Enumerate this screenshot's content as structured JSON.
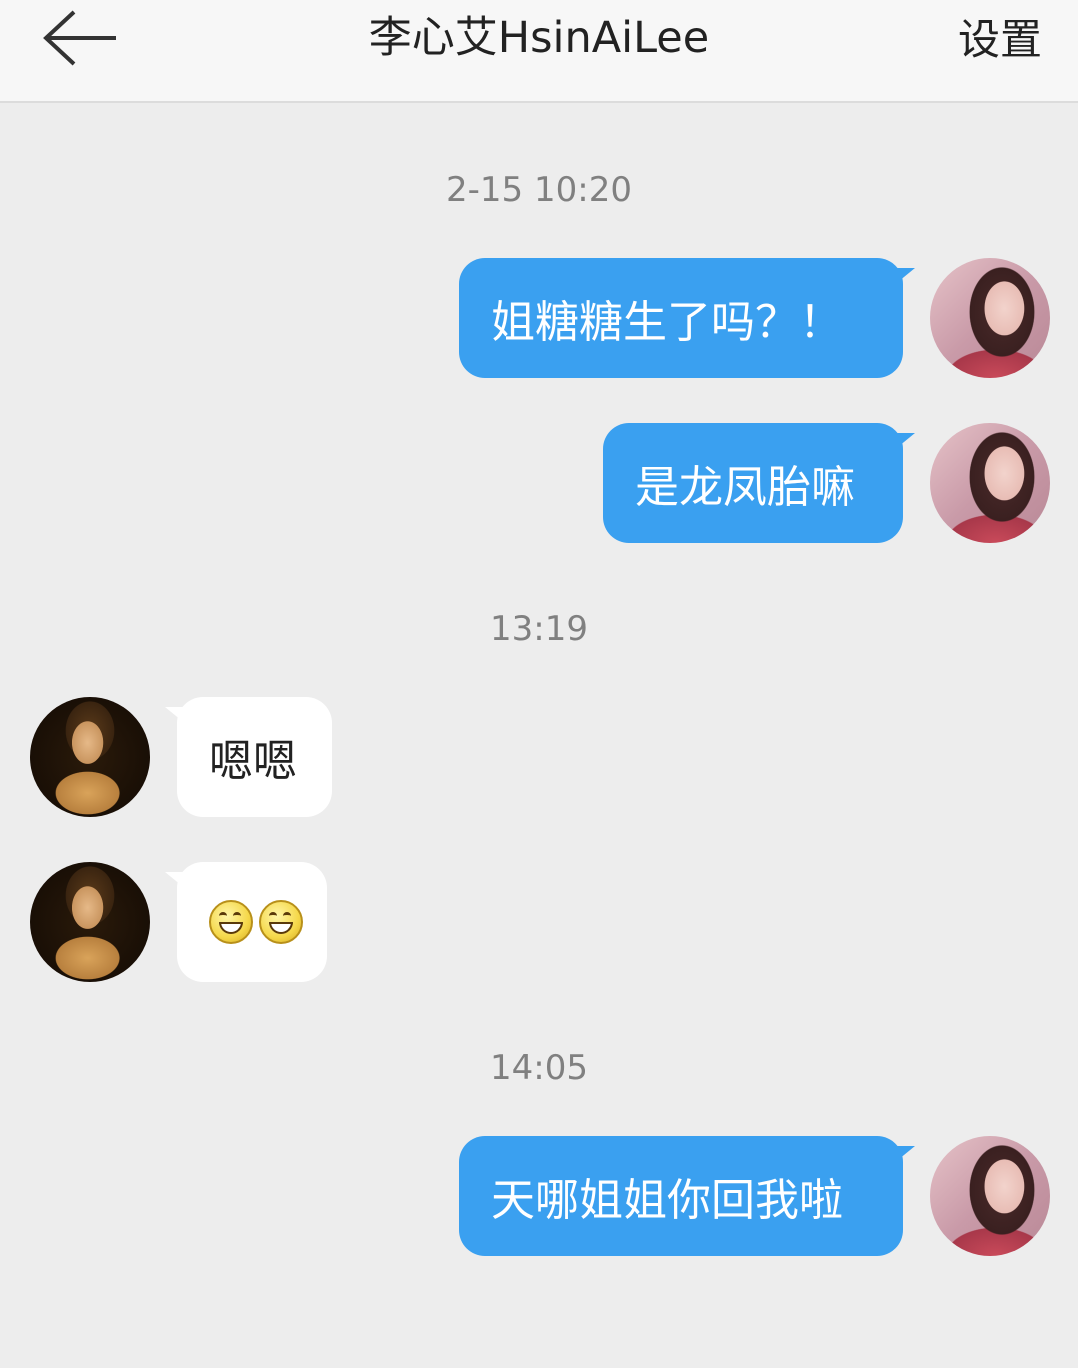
{
  "header": {
    "title": "李心艾HsinAiLee",
    "settings_label": "设置"
  },
  "timestamps": [
    "2-15 10:20",
    "13:19",
    "14:05"
  ],
  "messages": [
    {
      "side": "out",
      "text": "姐糖糖生了吗？！"
    },
    {
      "side": "out",
      "text": "是龙凤胎嘛"
    },
    {
      "side": "in",
      "text": "嗯嗯"
    },
    {
      "side": "in",
      "emoji": [
        "grin-icon",
        "grin-icon"
      ]
    },
    {
      "side": "out",
      "text": "天哪姐姐你回我啦"
    }
  ],
  "colors": {
    "outgoing_bubble": "#3aa0f0",
    "incoming_bubble": "#ffffff",
    "background": "#ededed"
  }
}
